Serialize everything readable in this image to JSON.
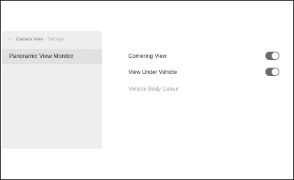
{
  "breadcrumb": {
    "back_icon": "chevron-left-icon",
    "back_glyph": "‹",
    "current": "Camera View",
    "separator": "·",
    "parent": "Settings"
  },
  "sidebar": {
    "items": [
      {
        "label": "Panoramic View Monitor",
        "chevron_glyph": "›",
        "selected": true
      }
    ]
  },
  "settings": [
    {
      "label": "Cornering View",
      "type": "toggle",
      "on": true
    },
    {
      "label": "View Under Vehicle",
      "type": "toggle",
      "on": true
    },
    {
      "label": "Vehicle Body Colour",
      "type": "item",
      "disabled": true
    }
  ],
  "colors": {
    "toggle_on": "#6b6b6b",
    "sidebar_bg": "#eeeeee",
    "sidebar_selected_bg": "#e1e1e1"
  }
}
